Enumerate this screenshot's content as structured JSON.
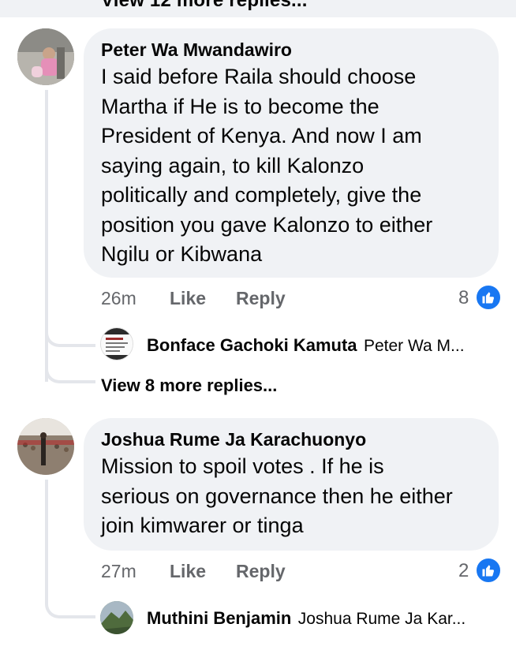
{
  "top": {
    "view_more_label": "View 12 more replies..."
  },
  "comments": [
    {
      "author": "Peter Wa Mwandawiro",
      "lines": [
        "I said before Raila should choose",
        "Martha if He is to become the",
        "President of Kenya. And now I am",
        "saying again, to kill Kalonzo",
        "politically and completely, give the",
        "position you gave Kalonzo to either",
        "Ngilu or Kibwana"
      ],
      "time": "26m",
      "like_label": "Like",
      "reply_label": "Reply",
      "reaction_count": "8",
      "reply_preview": {
        "name": "Bonface Gachoki Kamuta",
        "snippet": "Peter Wa M..."
      },
      "view_more_label": "View 8 more replies..."
    },
    {
      "author": "Joshua Rume Ja Karachuonyo",
      "lines": [
        "Mission to spoil votes . If he is",
        "serious on governance then he either",
        "join kimwarer or tinga"
      ],
      "time": "27m",
      "like_label": "Like",
      "reply_label": "Reply",
      "reaction_count": "2",
      "reply_preview": {
        "name": "Muthini Benjamin",
        "snippet": "Joshua Rume Ja Kar..."
      }
    }
  ],
  "colors": {
    "bubble": "#f0f2f5",
    "muted": "#65676b",
    "like_blue": "#1877f2",
    "thread_line": "#e4e6eb"
  },
  "icons": {
    "reaction": "thumbs-up-icon"
  }
}
